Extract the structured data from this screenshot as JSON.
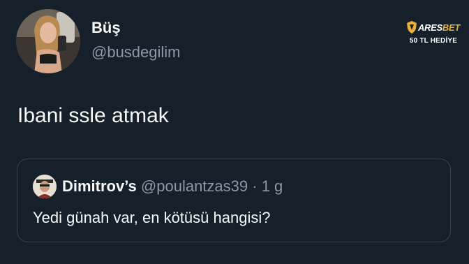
{
  "tweet": {
    "display_name": "Büş",
    "handle": "@busdegilim",
    "text": "Ibani ssle atmak"
  },
  "quoted_tweet": {
    "display_name": "Dimitrov’s",
    "handle": "@poulantzas39",
    "separator": "·",
    "time": "1 g",
    "text": "Yedi günah var, en kötüsü hangisi?"
  },
  "brand": {
    "name_part1": "ARES",
    "name_part2": "BET",
    "promo": "50 TL HEDİYE",
    "accent_color": "#e8b23a"
  },
  "colors": {
    "background": "#15202b",
    "primary_text": "#f7f9f9",
    "secondary_text": "#8b98a5",
    "card_border": "#38444d"
  }
}
